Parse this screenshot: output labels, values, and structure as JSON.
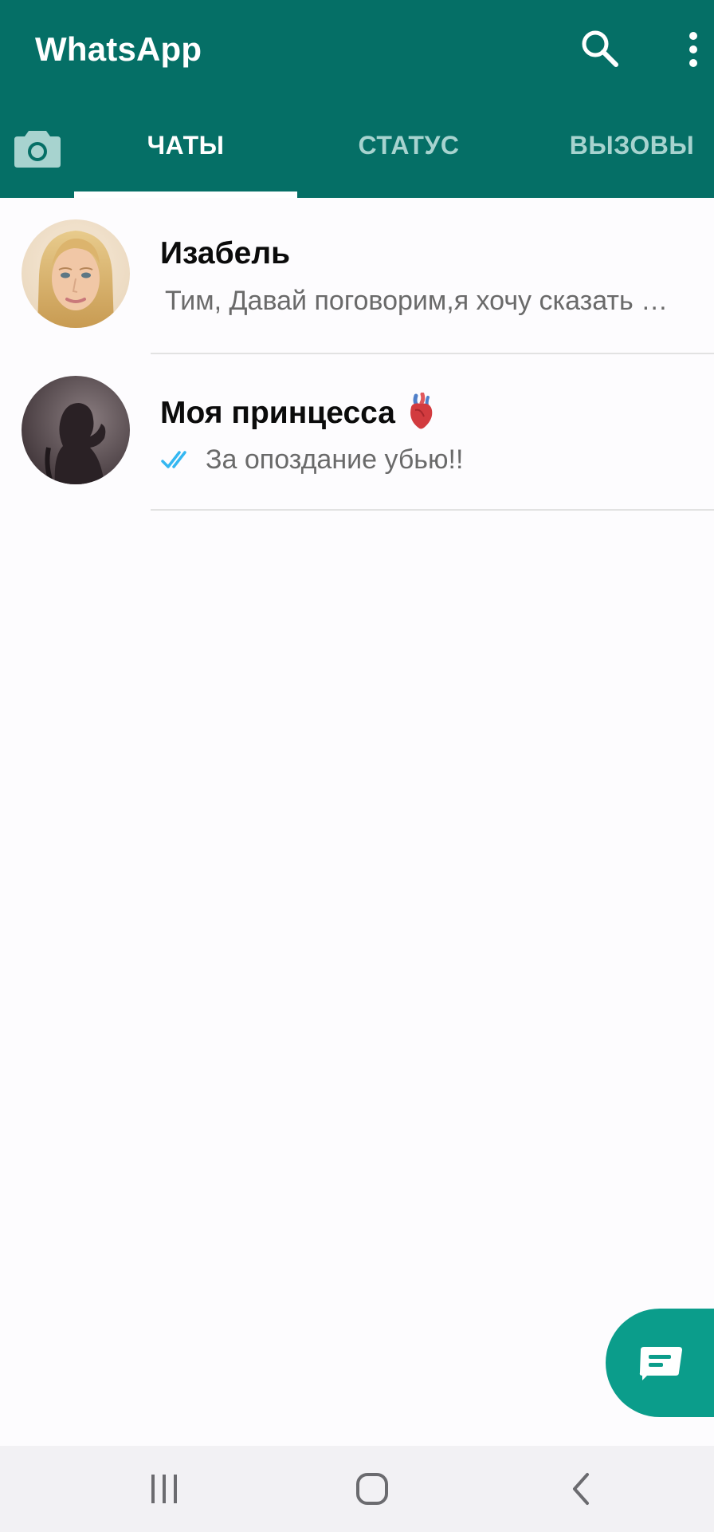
{
  "header": {
    "title": "WhatsApp",
    "tabs": [
      {
        "label": "ЧАТЫ",
        "active": true
      },
      {
        "label": "СТАТУС",
        "active": false
      },
      {
        "label": "ВЫЗОВЫ",
        "active": false
      }
    ]
  },
  "chats": [
    {
      "name": "Изабель",
      "preview": "Тим, Давай поговорим,я хочу сказать …",
      "read_receipt": false,
      "emoji": null
    },
    {
      "name": "Моя принцесса",
      "preview": "За опоздание убью!!",
      "read_receipt": true,
      "emoji": "anatomical-heart"
    }
  ],
  "icons": {
    "search": "search-icon",
    "menu": "more-vertical-icon",
    "camera": "camera-icon",
    "fab": "new-chat-icon",
    "nav": [
      "recent-apps-icon",
      "home-icon",
      "back-icon"
    ]
  },
  "colors": {
    "header": "#056f66",
    "fab": "#0b9d8b",
    "tab_inactive": "#a7d3cf",
    "read_ticks": "#34b7f1"
  }
}
